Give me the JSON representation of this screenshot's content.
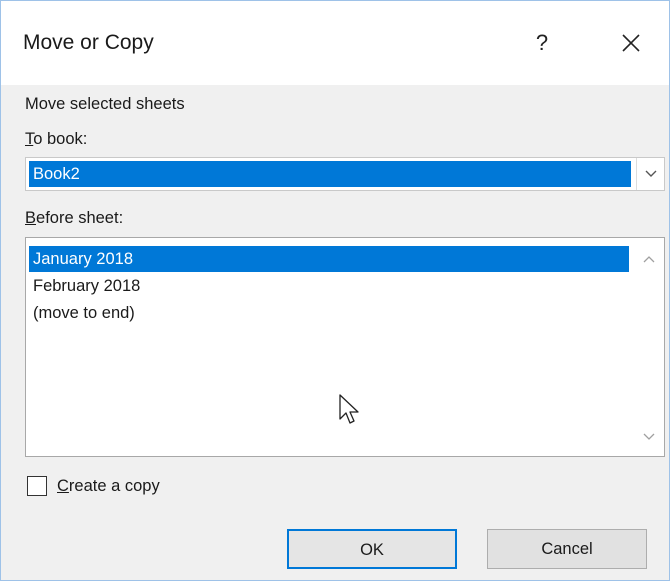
{
  "dialog": {
    "title": "Move or Copy",
    "help_label": "?",
    "close_label": "✕"
  },
  "move_label": "Move selected sheets",
  "to_book": {
    "label_ul": "T",
    "label_rest": "o book:",
    "selected": "Book2"
  },
  "before_sheet": {
    "label_ul": "B",
    "label_rest": "efore sheet:",
    "items": [
      "January 2018",
      "February 2018",
      "(move to end)"
    ],
    "selected_index": 0
  },
  "create_copy": {
    "label_ul": "C",
    "label_rest": "reate a copy",
    "checked": false
  },
  "buttons": {
    "ok": "OK",
    "cancel": "Cancel"
  },
  "colors": {
    "selection": "#0078d7",
    "focus_border": "#0078d7"
  }
}
